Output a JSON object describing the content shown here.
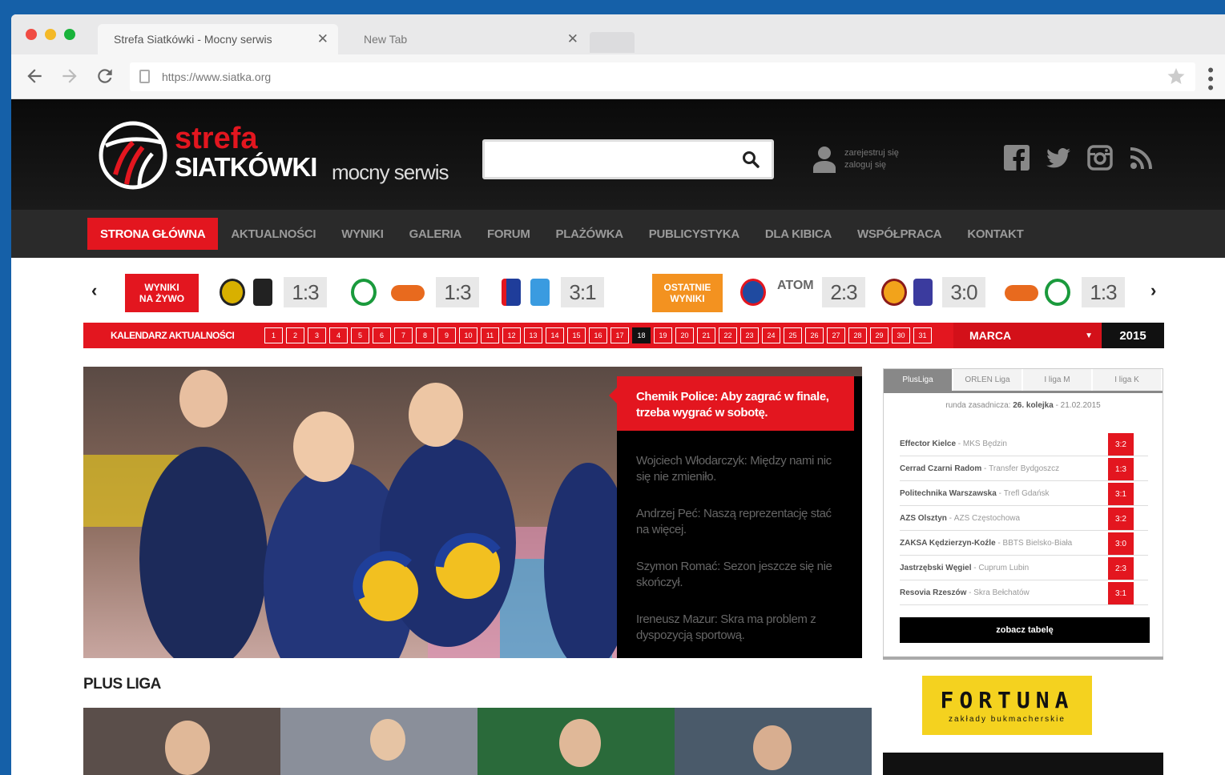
{
  "browser": {
    "tabs": [
      {
        "title": "Strefa Siatkówki - Mocny serwis"
      },
      {
        "title": "New Tab"
      }
    ],
    "close_glyph": "✕",
    "url": "https://www.siatka.org"
  },
  "site": {
    "logo": {
      "line1": "strefa",
      "line2": "SIATKÓWKI",
      "line3": "mocny serwis"
    },
    "user": {
      "register": "zarejestruj się",
      "login": "zaloguj się"
    },
    "social": [
      "facebook-icon",
      "twitter-icon",
      "instagram-icon",
      "rss-icon"
    ]
  },
  "nav": [
    {
      "label": "STRONA GŁÓWNA",
      "active": true
    },
    {
      "label": "AKTUALNOŚCI"
    },
    {
      "label": "WYNIKI"
    },
    {
      "label": "GALERIA"
    },
    {
      "label": "FORUM"
    },
    {
      "label": "PLAŻÓWKA"
    },
    {
      "label": "PUBLICYSTYKA"
    },
    {
      "label": "DLA KIBICA"
    },
    {
      "label": "WSPÓŁPRACA"
    },
    {
      "label": "KONTAKT"
    }
  ],
  "scores": {
    "live_label_1": "WYNIKI",
    "live_label_2": "NA ŻYWO",
    "recent_label_1": "OSTATNIE",
    "recent_label_2": "WYNIKI",
    "live": [
      "1:3",
      "1:3",
      "3:1"
    ],
    "recent": [
      "2:3",
      "3:0",
      "1:3"
    ],
    "atom": "ATOM",
    "prev": "‹",
    "next": "›"
  },
  "calendar": {
    "label": "KALENDARZ AKTUALNOŚCI",
    "days": [
      "1",
      "2",
      "3",
      "4",
      "5",
      "6",
      "7",
      "8",
      "9",
      "10",
      "11",
      "12",
      "13",
      "14",
      "15",
      "16",
      "17",
      "18",
      "19",
      "20",
      "21",
      "22",
      "23",
      "24",
      "25",
      "26",
      "27",
      "28",
      "29",
      "30",
      "31"
    ],
    "current": "18",
    "month": "MARCA",
    "year": "2015"
  },
  "hero": {
    "featured": "Chemik Police: Aby zagrać w finale, trzeba wygrać w sobotę.",
    "links": [
      "Wojciech Włodarczyk: Między nami nic się nie zmieniło.",
      "Andrzej Peć: Naszą reprezentację stać na więcej.",
      "Szymon Romać: Sezon jeszcze się nie skończył.",
      "Ireneusz Mazur: Skra ma problem z dyspozycją sportową."
    ]
  },
  "standings": {
    "tabs": [
      "PlusLiga",
      "ORLEN Liga",
      "I liga M",
      "I liga K"
    ],
    "subtitle_prefix": "runda zasadnicza:",
    "subtitle_round": "26. kolejka",
    "subtitle_date": "- 21.02.2015",
    "rows": [
      {
        "home": "Effector Kielce",
        "away": "MKS Będzin",
        "result": "3:2"
      },
      {
        "home": "Cerrad Czarni Radom",
        "away": "Transfer Bydgoszcz",
        "result": "1:3"
      },
      {
        "home": "Politechnika Warszawska",
        "away": "Trefl Gdańsk",
        "result": "3:1"
      },
      {
        "home": "AZS Olsztyn",
        "away": "AZS Częstochowa",
        "result": "3:2"
      },
      {
        "home": "ZAKSA Kędzierzyn-Koźle",
        "away": "BBTS Bielsko-Biała",
        "result": "3:0"
      },
      {
        "home": "Jastrzębski Węgiel",
        "away": "Cuprum Lubin",
        "result": "2:3"
      },
      {
        "home": "Resovia Rzeszów",
        "away": "Skra Bełchatów",
        "result": "3:1"
      }
    ],
    "button": "zobacz tabelę"
  },
  "section_title": "PLUS LIGA",
  "ad": {
    "name": "FORTUNA",
    "sub": "zakłady bukmacherskie"
  },
  "colors": {
    "brand_red": "#e3161f",
    "orange": "#f39220",
    "header_black": "#111111"
  }
}
